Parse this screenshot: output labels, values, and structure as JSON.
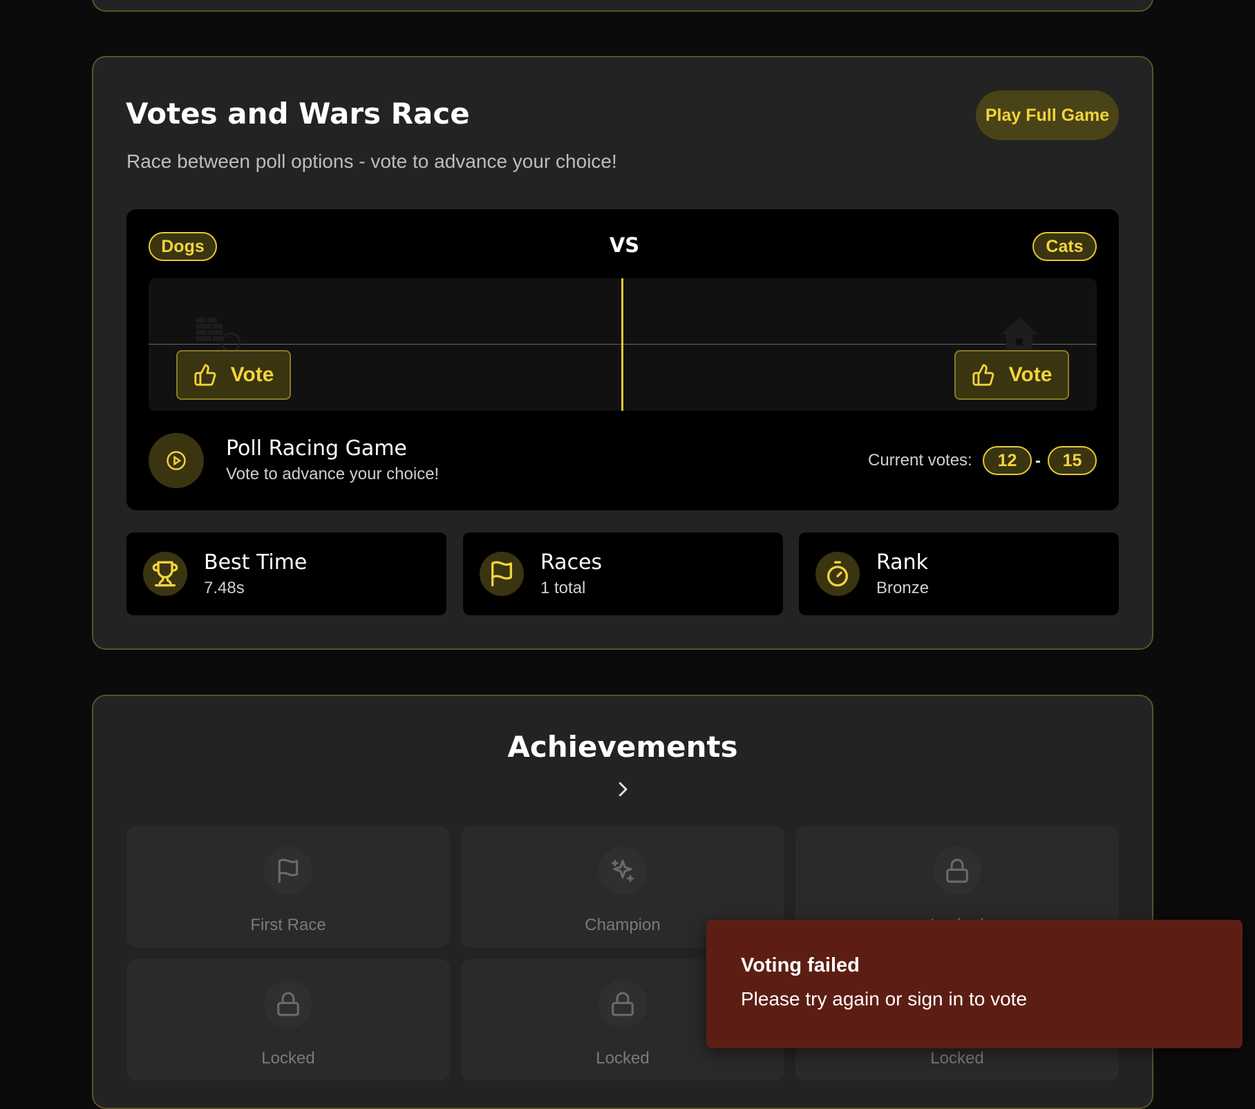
{
  "race_section": {
    "title": "Votes and Wars Race",
    "play_button": "Play Full Game",
    "subtitle": "Race between poll options - vote to advance your choice!",
    "left_option": "Dogs",
    "vs_label": "VS",
    "right_option": "Cats",
    "vote_left_label": "Vote",
    "vote_right_label": "Vote",
    "game_title": "Poll Racing Game",
    "game_subtitle": "Vote to advance your choice!",
    "current_votes_label": "Current votes:",
    "votes_left": "12",
    "votes_separator": "-",
    "votes_right": "15"
  },
  "stats": [
    {
      "title": "Best Time",
      "value": "7.48s",
      "icon": "trophy-icon"
    },
    {
      "title": "Races",
      "value": "1 total",
      "icon": "flag-icon"
    },
    {
      "title": "Rank",
      "value": "Bronze",
      "icon": "stopwatch-icon"
    }
  ],
  "achievements": {
    "title": "Achievements",
    "items": [
      {
        "label": "First Race",
        "icon": "flag-icon"
      },
      {
        "label": "Champion",
        "icon": "sparkle-icon"
      },
      {
        "label": "Locked",
        "icon": "lock-icon"
      },
      {
        "label": "Locked",
        "icon": "lock-icon"
      },
      {
        "label": "Locked",
        "icon": "lock-icon"
      },
      {
        "label": "Locked",
        "icon": "lock-icon"
      }
    ]
  },
  "toast": {
    "title": "Voting failed",
    "message": "Please try again or sign in to vote"
  },
  "colors": {
    "accent": "#f2d43a",
    "card_bg": "#232323",
    "page_bg": "#0b0b0b",
    "toast_bg": "#5c1e14"
  }
}
